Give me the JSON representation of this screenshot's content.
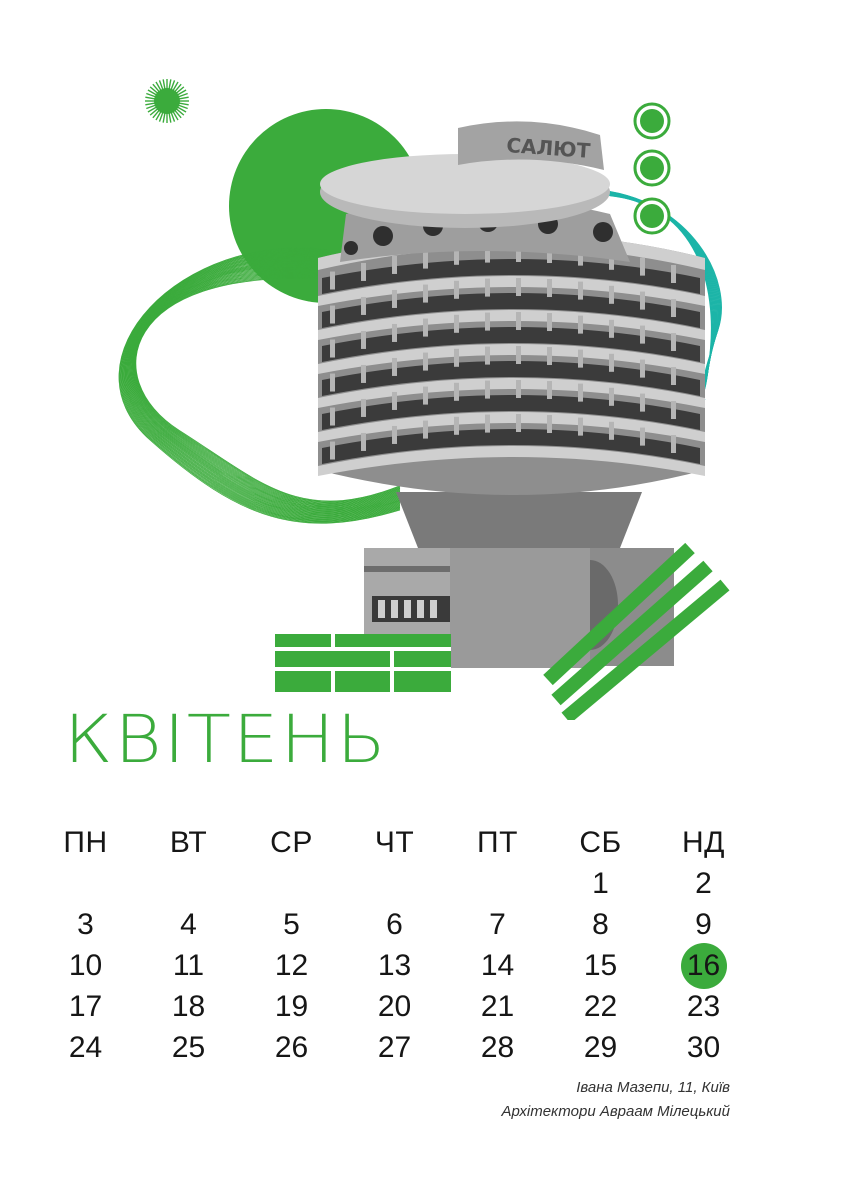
{
  "colors": {
    "accent": "#3bab3c",
    "teal": "#1db5a8",
    "text": "#161616"
  },
  "month": "КВІТЕНЬ",
  "calendar": {
    "weekdays": [
      "ПН",
      "ВТ",
      "СР",
      "ЧТ",
      "ПТ",
      "СБ",
      "НД"
    ],
    "weeks": [
      [
        "",
        "",
        "",
        "",
        "",
        "1",
        "2"
      ],
      [
        "3",
        "4",
        "5",
        "6",
        "7",
        "8",
        "9"
      ],
      [
        "10",
        "11",
        "12",
        "13",
        "14",
        "15",
        "16"
      ],
      [
        "17",
        "18",
        "19",
        "20",
        "21",
        "22",
        "23"
      ],
      [
        "24",
        "25",
        "26",
        "27",
        "28",
        "29",
        "30"
      ]
    ],
    "highlighted_day": "16"
  },
  "caption": {
    "address": "Івана Мазепи, 11, Київ",
    "architects": "Архітектори Авраам Мілецький"
  },
  "illustration": {
    "building_sign": "САЛЮТ",
    "icons": [
      "sun-burst-icon",
      "ring-dot-icon"
    ]
  }
}
